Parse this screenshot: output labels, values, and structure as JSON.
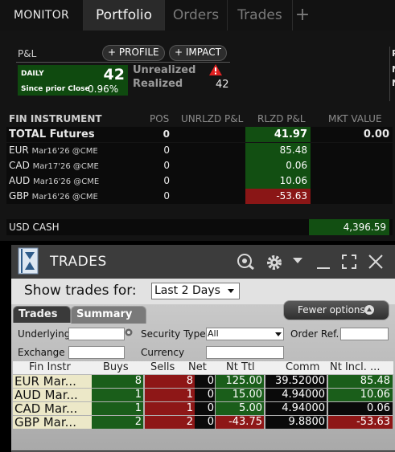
{
  "tabs": [
    {
      "label": "MONITOR",
      "active": false
    },
    {
      "label": "Portfolio",
      "active": true
    },
    {
      "label": "Orders",
      "active": false
    },
    {
      "label": "Trades",
      "active": false
    }
  ],
  "add_tab_icon": "plus-icon",
  "pnl": {
    "label": "P&L",
    "profile_btn": "+ PROFILE",
    "impact_btn": "+ IMPACT",
    "daily_label": "DAILY",
    "daily_value": "42",
    "since_label": "Since prior Close",
    "since_pct": "0.96%",
    "unrealized_label": "Unrealized",
    "realized_label": "Realized",
    "realized_value": "42",
    "warning_icon": "alert-icon",
    "right_edge": [
      "P",
      "N",
      "N"
    ]
  },
  "positions": {
    "headers": {
      "instrument": "FIN INSTRUMENT",
      "pos": "POS",
      "unrlzd": "UNRLZD P&L",
      "rlzd": "RLZD P&L",
      "mkt": "MKT VALUE"
    },
    "total": {
      "label": "TOTAL Futures",
      "pos": "0",
      "rlzd": "41.97",
      "mkt": "0.00"
    },
    "rows": [
      {
        "sym": "EUR",
        "detail": "Mar16'26 @CME",
        "pos": "0",
        "rlzd": "85.48",
        "color": "green"
      },
      {
        "sym": "CAD",
        "detail": "Mar17'26 @CME",
        "pos": "0",
        "rlzd": "0.06",
        "color": "green"
      },
      {
        "sym": "AUD",
        "detail": "Mar16'26 @CME",
        "pos": "0",
        "rlzd": "10.06",
        "color": "green"
      },
      {
        "sym": "GBP",
        "detail": "Mar16'26 @CME",
        "pos": "0",
        "rlzd": "-53.63",
        "color": "red"
      }
    ],
    "cash": {
      "label": "USD CASH",
      "value": "4,396.59"
    }
  },
  "trades_window": {
    "title": "TRADES",
    "icons": [
      "chat-search-icon",
      "gear-icon",
      "chevron-down-icon",
      "minimize-icon",
      "maximize-icon",
      "close-icon"
    ],
    "show_label": "Show trades for:",
    "period": "Last 2 Days",
    "subtabs": [
      "Trades",
      "Summary"
    ],
    "fewer_options": "Fewer options",
    "filters": {
      "underlying": "Underlying",
      "security_type": "Security Type",
      "security_type_value": "All",
      "order_ref": "Order Ref.",
      "exchange": "Exchange",
      "currency": "Currency"
    },
    "columns": [
      "Fin Instr",
      "Buys",
      "Sells",
      "Net",
      "Nt Ttl",
      "Comm",
      "Nt Incl. ..."
    ],
    "rows": [
      {
        "instr": "EUR Mar...",
        "buys": "8",
        "sells": "8",
        "net": "0",
        "ntl": "125.00",
        "ntl_color": "green",
        "comm": "39.52000",
        "incl": "85.48",
        "incl_color": "green"
      },
      {
        "instr": "AUD Mar...",
        "buys": "1",
        "sells": "1",
        "net": "0",
        "ntl": "15.00",
        "ntl_color": "green",
        "comm": "4.94000",
        "incl": "10.06",
        "incl_color": "green"
      },
      {
        "instr": "CAD Mar...",
        "buys": "1",
        "sells": "1",
        "net": "0",
        "ntl": "5.00",
        "ntl_color": "green",
        "comm": "4.94000",
        "incl": "0.06",
        "incl_color": "dark"
      },
      {
        "instr": "GBP Mar...",
        "buys": "2",
        "sells": "2",
        "net": "0",
        "ntl": "-43.75",
        "ntl_color": "red",
        "comm": "9.8800",
        "incl": "-53.63",
        "incl_color": "red"
      }
    ]
  }
}
